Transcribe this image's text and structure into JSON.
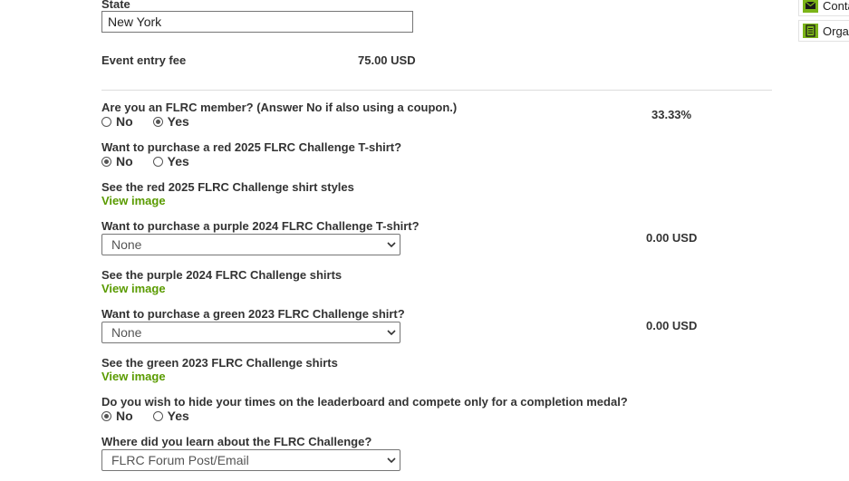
{
  "address": {
    "state_label": "State",
    "state_value": "New York"
  },
  "fee": {
    "label": "Event entry fee",
    "amount": "75.00 USD"
  },
  "questions": {
    "member": {
      "label": "Are you an FLRC member? (Answer No if also using a coupon.)",
      "option_no": "No",
      "option_yes": "Yes",
      "selected": "Yes",
      "discount": "33.33%"
    },
    "red_shirt": {
      "label": "Want to purchase a red 2025 FLRC Challenge T-shirt?",
      "option_no": "No",
      "option_yes": "Yes",
      "selected": "No"
    },
    "red_shirt_styles": {
      "label": "See the red 2025 FLRC Challenge shirt styles",
      "link": "View image"
    },
    "purple_shirt": {
      "label": "Want to purchase a purple 2024 FLRC Challenge T-shirt?",
      "selected_option": "None",
      "price": "0.00 USD"
    },
    "purple_shirt_images": {
      "label": "See the purple 2024 FLRC Challenge shirts",
      "link": "View image"
    },
    "green_shirt": {
      "label": "Want to purchase a green 2023 FLRC Challenge shirt?",
      "selected_option": "None",
      "price": "0.00 USD"
    },
    "green_shirt_images": {
      "label": "See the green 2023 FLRC Challenge shirts",
      "link": "View image"
    },
    "hide_times": {
      "label": "Do you wish to hide your times on the leaderboard and compete only for a completion medal?",
      "option_no": "No",
      "option_yes": "Yes",
      "selected": "No"
    },
    "learn_source": {
      "label": "Where did you learn about the FLRC Challenge?",
      "selected_option": "FLRC Forum Post/Email"
    }
  },
  "sidebar": {
    "contact_label": "Conta",
    "organizer_label": "Organ"
  },
  "colors": {
    "link_green": "#5a9b00",
    "icon_green": "#7cb518"
  },
  "icons": {
    "contact": "envelope-icon",
    "organizer": "document-icon",
    "select_chevron": "chevron-down-icon"
  }
}
